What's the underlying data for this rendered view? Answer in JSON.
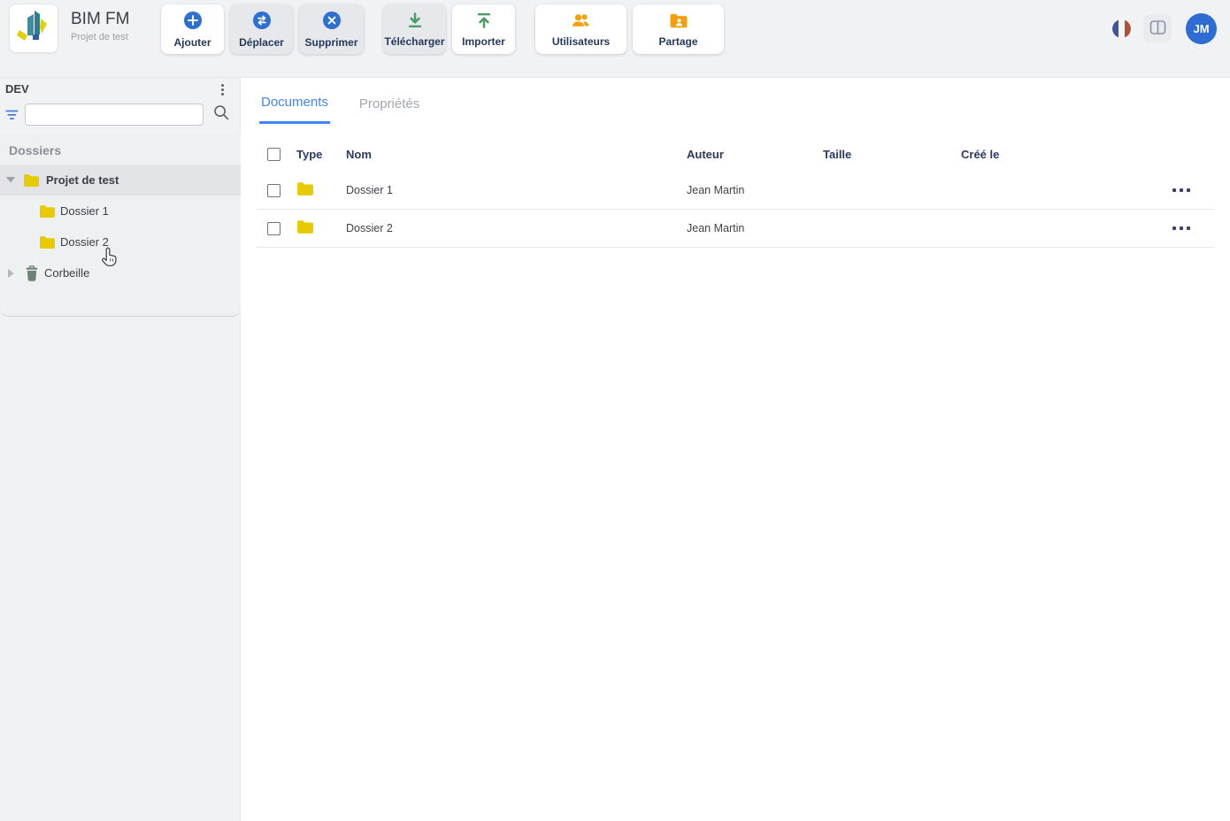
{
  "colors": {
    "accent_blue": "#2e6fd2",
    "tab_blue": "#4285f4",
    "folder_yellow": "#e8ca00",
    "icon_orange": "#f59f0a",
    "icon_green": "#4e9d69",
    "avatar_blue": "#2e6bd3",
    "trash_green": "#6b8377"
  },
  "topbar": {
    "app_title": "BIM FM",
    "app_subtitle": "Projet de test",
    "buttons": [
      {
        "label": "Ajouter",
        "icon": "plus-circle-icon"
      },
      {
        "label": "Déplacer",
        "icon": "swap-circle-icon"
      },
      {
        "label": "Supprimer",
        "icon": "close-circle-icon"
      },
      {
        "label": "Télécharger",
        "icon": "download-icon"
      },
      {
        "label": "Importer",
        "icon": "upload-icon"
      },
      {
        "label": "Utilisateurs",
        "icon": "users-icon"
      },
      {
        "label": "Partage",
        "icon": "share-folder-icon"
      }
    ],
    "language_flag": "fr",
    "avatar_initials": "JM"
  },
  "sidebar": {
    "workspace_label": "DEV",
    "search": {
      "value": "",
      "placeholder": ""
    },
    "section_title": "Dossiers",
    "tree": [
      {
        "label": "Projet de test",
        "icon": "folder",
        "level": 0,
        "expanded": true,
        "selected": true
      },
      {
        "label": "Dossier 1",
        "icon": "folder",
        "level": 1
      },
      {
        "label": "Dossier 2",
        "icon": "folder",
        "level": 1
      },
      {
        "label": "Corbeille",
        "icon": "trash",
        "level": 0,
        "expanded": false
      }
    ]
  },
  "main": {
    "tabs": [
      {
        "label": "Documents",
        "active": true
      },
      {
        "label": "Propriétés",
        "active": false
      }
    ],
    "table": {
      "columns": {
        "type": "Type",
        "name": "Nom",
        "author": "Auteur",
        "size": "Taille",
        "created": "Créé le"
      },
      "rows": [
        {
          "type": "folder",
          "name": "Dossier 1",
          "author": "Jean Martin",
          "size": "",
          "created": ""
        },
        {
          "type": "folder",
          "name": "Dossier 2",
          "author": "Jean Martin",
          "size": "",
          "created": ""
        }
      ]
    }
  }
}
